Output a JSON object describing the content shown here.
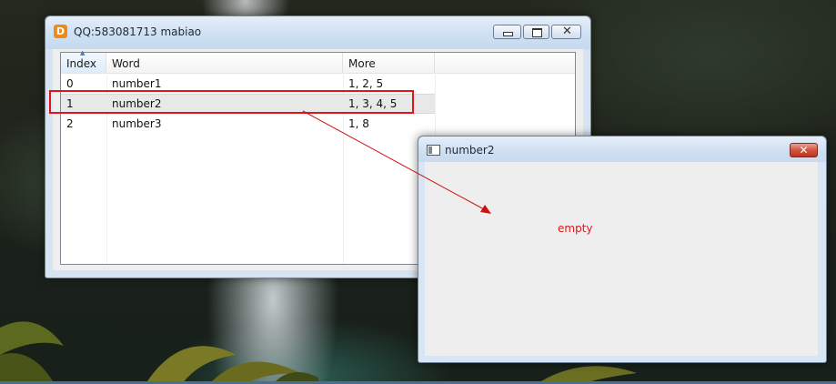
{
  "main_window": {
    "title": "QQ:583081713 mabiao",
    "app_icon_glyph": "D",
    "app_icon_color": "#f08a16",
    "controls": {
      "minimize": "minimize-icon",
      "maximize": "maximize-icon",
      "close": "close-icon"
    },
    "table": {
      "columns": [
        "Index",
        "Word",
        "More"
      ],
      "sort_indicator": "▲",
      "rows": [
        {
          "index": "0",
          "word": "number1",
          "more": "1, 2, 5"
        },
        {
          "index": "1",
          "word": "number2",
          "more": "1, 3, 4, 5",
          "selected": true
        },
        {
          "index": "2",
          "word": "number3",
          "more": "1, 8"
        }
      ]
    }
  },
  "child_window": {
    "title": "number2",
    "close_glyph": "✕",
    "close_color": "#c2321d",
    "content_text": "empty",
    "content_text_color": "#e0161c"
  },
  "annotation": {
    "highlight_color": "#e0161c",
    "arrow_color": "#cc1111"
  }
}
